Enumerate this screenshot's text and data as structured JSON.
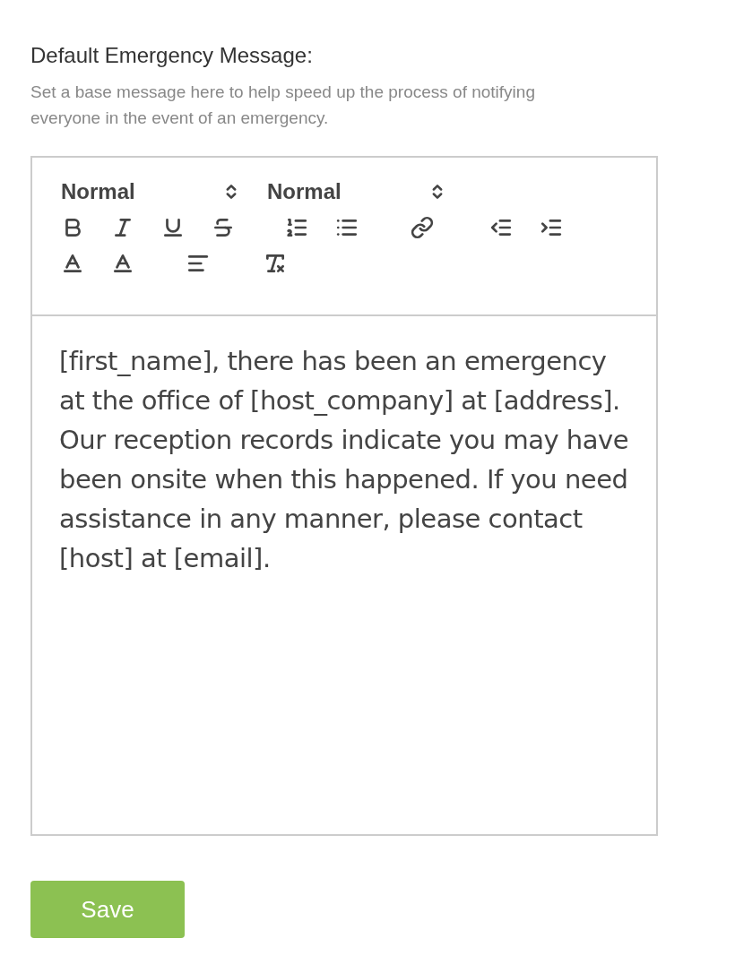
{
  "label": "Default Emergency Message:",
  "hint": "Set a base message here to help speed up the process of notifying everyone in the event of an emergency.",
  "editor": {
    "selects": [
      "Normal",
      "Normal"
    ],
    "body": "[first_name], there has been an emergency at the office of [host_company] at [address]. Our reception records indicate you may have been onsite when this happened. If you need assistance in any manner, please contact [host] at [email]."
  },
  "save_button": "Save"
}
